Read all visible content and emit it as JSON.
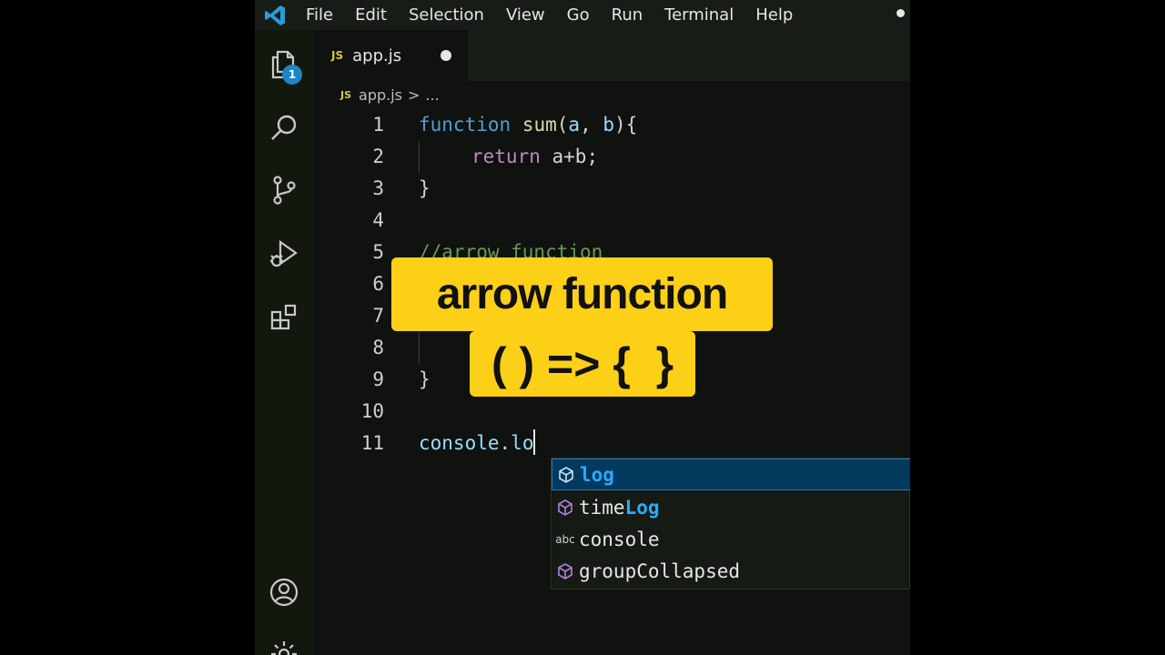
{
  "menu": {
    "items": [
      "File",
      "Edit",
      "Selection",
      "View",
      "Go",
      "Run",
      "Terminal",
      "Help"
    ]
  },
  "activity_bar": {
    "explorer_badge": "1",
    "icons": [
      "files-icon",
      "search-icon",
      "source-control-icon",
      "run-debug-icon",
      "extensions-icon",
      "account-icon",
      "gear-icon"
    ]
  },
  "tab": {
    "badge": "JS",
    "filename": "app.js"
  },
  "breadcrumb": {
    "badge": "JS",
    "file": "app.js",
    "separator": ">",
    "rest": "..."
  },
  "editor": {
    "line_numbers": [
      "1",
      "2",
      "3",
      "4",
      "5",
      "6",
      "7",
      "8",
      "9",
      "10",
      "11"
    ],
    "line1": {
      "kw": "function",
      "fn": "sum",
      "open": "(",
      "p1": "a",
      "comma": ", ",
      "p2": "b",
      "close": "){"
    },
    "line2": {
      "kw": "return",
      "expr": "a+b;"
    },
    "line3": "}",
    "line5": "//arrow function",
    "line9": "}",
    "line11": {
      "obj": "console",
      "dot": ".",
      "typed": "lo"
    }
  },
  "suggestions": [
    {
      "icon": "cube-icon",
      "match": "log",
      "rest": "",
      "selected": true
    },
    {
      "icon": "cube-icon",
      "prefix": "time",
      "match": "Log",
      "rest": "",
      "selected": false
    },
    {
      "icon": "abc-icon",
      "icon_text": "abc",
      "match": "",
      "rest": "console",
      "selected": false
    },
    {
      "icon": "cube-icon",
      "match": "",
      "rest": "groupCollapsed",
      "selected": false
    }
  ],
  "captions": {
    "title": "arrow function",
    "syntax": "( ) => {  }"
  },
  "colors": {
    "caption_bg": "#fdd018",
    "selected_bg": "#04395e",
    "match": "#2aaaff"
  }
}
